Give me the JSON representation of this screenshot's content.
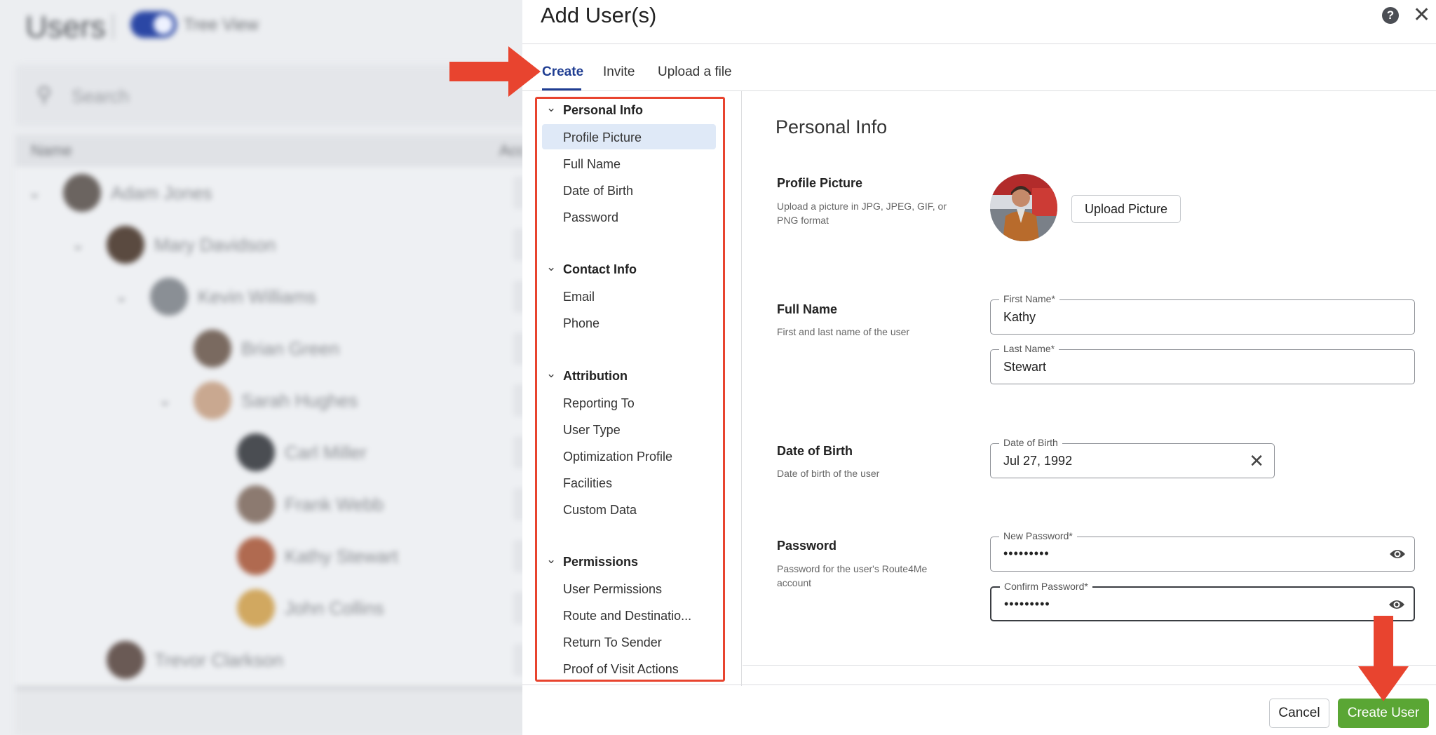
{
  "background": {
    "title": "Users",
    "tree_view_label": "Tree View",
    "search_placeholder": "Search",
    "col_name": "Name",
    "col_second": "Acc",
    "rows": [
      {
        "name": "Adam Jones",
        "indent": 0,
        "expanded": true,
        "avatar_color": "#6b6460"
      },
      {
        "name": "Mary Davidson",
        "indent": 1,
        "expanded": true,
        "avatar_color": "#5a4a40"
      },
      {
        "name": "Kevin Williams",
        "indent": 2,
        "expanded": true,
        "avatar_color": "#8a8f95"
      },
      {
        "name": "Brian Green",
        "indent": 3,
        "expanded": false,
        "avatar_color": "#7a6a60"
      },
      {
        "name": "Sarah Hughes",
        "indent": 3,
        "expanded": true,
        "avatar_color": "#c9a890"
      },
      {
        "name": "Carl Miller",
        "indent": 4,
        "expanded": false,
        "avatar_color": "#4a4d52"
      },
      {
        "name": "Frank Webb",
        "indent": 4,
        "expanded": false,
        "avatar_color": "#8c7a70"
      },
      {
        "name": "Kathy Stewart",
        "indent": 4,
        "expanded": false,
        "avatar_color": "#b06a50"
      },
      {
        "name": "John Collins",
        "indent": 4,
        "expanded": false,
        "avatar_color": "#d1a860"
      },
      {
        "name": "Trevor Clarkson",
        "indent": 1,
        "expanded": false,
        "avatar_color": "#6a5a55"
      }
    ]
  },
  "modal": {
    "title": "Add User(s)",
    "help_icon": "question-circle-icon",
    "close_icon": "close-icon",
    "tabs": [
      {
        "label": "Create",
        "active": true
      },
      {
        "label": "Invite",
        "active": false
      },
      {
        "label": "Upload a file",
        "active": false
      }
    ],
    "nav": {
      "groups": [
        {
          "label": "Personal Info",
          "items": [
            "Profile Picture",
            "Full Name",
            "Date of Birth",
            "Password"
          ]
        },
        {
          "label": "Contact Info",
          "items": [
            "Email",
            "Phone"
          ]
        },
        {
          "label": "Attribution",
          "items": [
            "Reporting To",
            "User Type",
            "Optimization Profile",
            "Facilities",
            "Custom Data"
          ]
        },
        {
          "label": "Permissions",
          "items": [
            "User Permissions",
            "Route and Destinatio...",
            "Return To Sender",
            "Proof of Visit Actions"
          ]
        }
      ],
      "selected_item": "Profile Picture"
    },
    "content": {
      "section_title": "Personal Info",
      "profile_picture": {
        "title": "Profile Picture",
        "description": "Upload a picture in JPG, JPEG, GIF, or PNG format",
        "upload_label": "Upload Picture"
      },
      "full_name": {
        "title": "Full Name",
        "description": "First and last name of the user",
        "first_name_label": "First Name*",
        "first_name_value": "Kathy",
        "last_name_label": "Last Name*",
        "last_name_value": "Stewart"
      },
      "date_of_birth": {
        "title": "Date of Birth",
        "description": "Date of birth of the user",
        "field_label": "Date of Birth",
        "value": "Jul 27, 1992"
      },
      "password": {
        "title": "Password",
        "description": "Password for the user's Route4Me account",
        "new_label": "New Password*",
        "new_value": "•••••••••",
        "confirm_label": "Confirm Password*",
        "confirm_value": "•••••••••"
      }
    },
    "footer": {
      "cancel_label": "Cancel",
      "create_label": "Create User"
    }
  },
  "colors": {
    "accent": "#1f3d92",
    "selected_bg": "#dfe9f7",
    "annotation": "#e8442f",
    "primary_button": "#5aa634"
  }
}
